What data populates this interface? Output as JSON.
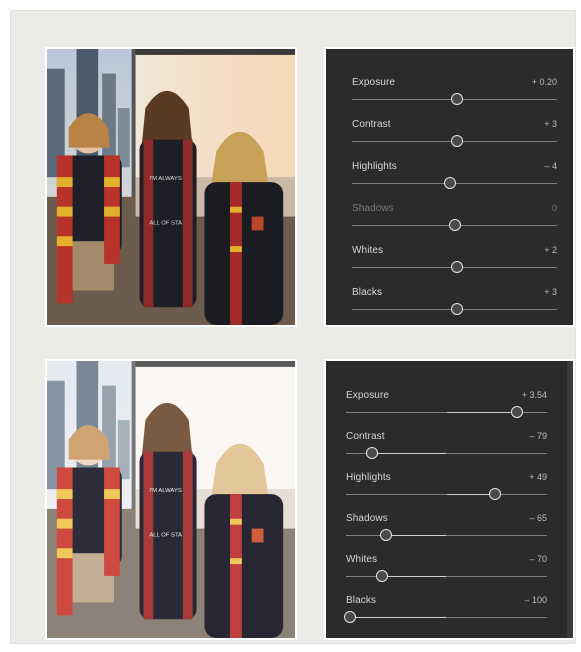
{
  "panels": [
    {
      "id": "top",
      "sliders": [
        {
          "label": "Exposure",
          "value": "+ 0.20",
          "position": 0.51,
          "disabled": false
        },
        {
          "label": "Contrast",
          "value": "+ 3",
          "position": 0.51,
          "disabled": false
        },
        {
          "label": "Highlights",
          "value": "– 4",
          "position": 0.48,
          "disabled": false
        },
        {
          "label": "Shadows",
          "value": "0",
          "position": 0.5,
          "disabled": true
        },
        {
          "label": "Whites",
          "value": "+ 2",
          "position": 0.51,
          "disabled": false
        },
        {
          "label": "Blacks",
          "value": "+ 3",
          "position": 0.51,
          "disabled": false
        }
      ]
    },
    {
      "id": "bottom",
      "sliders": [
        {
          "label": "Exposure",
          "value": "+ 3.54",
          "position": 0.85,
          "disabled": false
        },
        {
          "label": "Contrast",
          "value": "– 79",
          "position": 0.13,
          "disabled": false
        },
        {
          "label": "Highlights",
          "value": "+ 49",
          "position": 0.74,
          "disabled": false
        },
        {
          "label": "Shadows",
          "value": "– 65",
          "position": 0.2,
          "disabled": false
        },
        {
          "label": "Whites",
          "value": "– 70",
          "position": 0.18,
          "disabled": false
        },
        {
          "label": "Blacks",
          "value": "– 100",
          "position": 0.02,
          "disabled": false
        }
      ]
    }
  ],
  "photo_text": {
    "shirt_line1": "I'M ALWAYS",
    "shirt_line2": "ALL OF STA"
  }
}
